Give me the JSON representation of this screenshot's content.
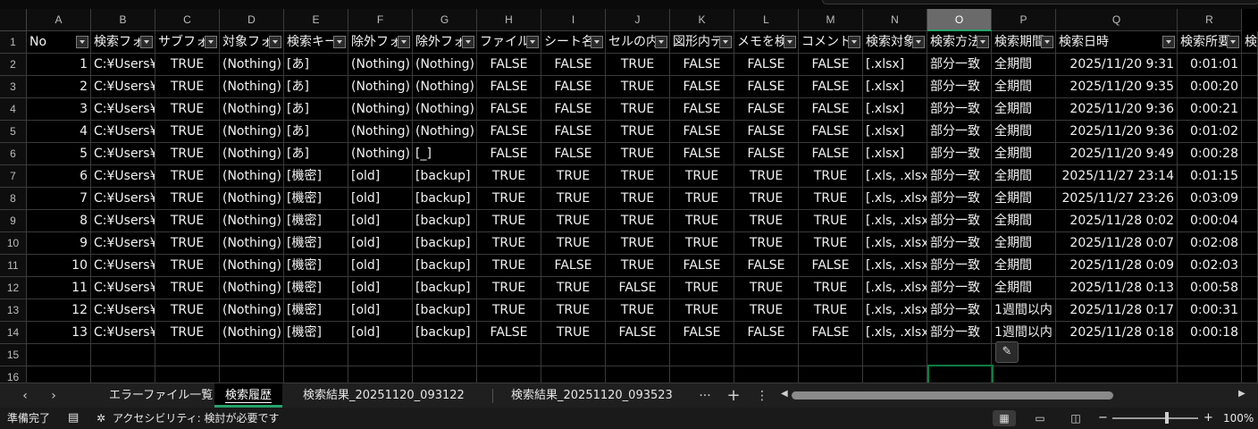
{
  "columns": [
    "A",
    "B",
    "C",
    "D",
    "E",
    "F",
    "G",
    "H",
    "I",
    "J",
    "K",
    "L",
    "M",
    "N",
    "O",
    "P",
    "Q",
    "R"
  ],
  "selected_column": "O",
  "row_numbers": [
    "1",
    "2",
    "3",
    "4",
    "5",
    "6",
    "7",
    "8",
    "9",
    "10",
    "11",
    "12",
    "13",
    "14",
    "15",
    "16"
  ],
  "header_row": [
    "No",
    "検索フォ",
    "サブフォ",
    "対象フォ",
    "検索キー",
    "除外フォ",
    "除外フォ",
    "ファイル",
    "シート名",
    "セルの内",
    "図形内テ",
    "メモを検",
    "コメント",
    "検索対象",
    "検索方法",
    "検索期間",
    "検索日時",
    "検索所要"
  ],
  "header_next_fragment": "検",
  "rows": [
    [
      "1",
      "C:¥Users¥",
      "TRUE",
      "(Nothing)",
      "[あ]",
      "(Nothing)",
      "(Nothing)",
      "FALSE",
      "FALSE",
      "TRUE",
      "FALSE",
      "FALSE",
      "FALSE",
      "[.xlsx]",
      "部分一致",
      "全期間",
      "2025/11/20 9:31",
      "0:01:01"
    ],
    [
      "2",
      "C:¥Users¥",
      "TRUE",
      "(Nothing)",
      "[あ]",
      "(Nothing)",
      "(Nothing)",
      "FALSE",
      "FALSE",
      "TRUE",
      "FALSE",
      "FALSE",
      "FALSE",
      "[.xlsx]",
      "部分一致",
      "全期間",
      "2025/11/20 9:35",
      "0:00:20"
    ],
    [
      "3",
      "C:¥Users¥",
      "TRUE",
      "(Nothing)",
      "[あ]",
      "(Nothing)",
      "(Nothing)",
      "FALSE",
      "FALSE",
      "TRUE",
      "FALSE",
      "FALSE",
      "FALSE",
      "[.xlsx]",
      "部分一致",
      "全期間",
      "2025/11/20 9:36",
      "0:00:21"
    ],
    [
      "4",
      "C:¥Users¥",
      "TRUE",
      "(Nothing)",
      "[あ]",
      "(Nothing)",
      "(Nothing)",
      "FALSE",
      "FALSE",
      "TRUE",
      "FALSE",
      "FALSE",
      "FALSE",
      "[.xlsx]",
      "部分一致",
      "全期間",
      "2025/11/20 9:36",
      "0:01:02"
    ],
    [
      "5",
      "C:¥Users¥",
      "TRUE",
      "(Nothing)",
      "[あ]",
      "(Nothing)",
      "[_]",
      "FALSE",
      "FALSE",
      "TRUE",
      "FALSE",
      "FALSE",
      "FALSE",
      "[.xlsx]",
      "部分一致",
      "全期間",
      "2025/11/20 9:49",
      "0:00:28"
    ],
    [
      "6",
      "C:¥Users¥",
      "TRUE",
      "(Nothing)",
      "[機密]",
      "[old]",
      "[backup]",
      "TRUE",
      "TRUE",
      "TRUE",
      "TRUE",
      "TRUE",
      "TRUE",
      "[.xls, .xlsx,",
      "部分一致",
      "全期間",
      "2025/11/27 23:14",
      "0:01:15"
    ],
    [
      "7",
      "C:¥Users¥",
      "TRUE",
      "(Nothing)",
      "[機密]",
      "[old]",
      "[backup]",
      "TRUE",
      "TRUE",
      "TRUE",
      "TRUE",
      "TRUE",
      "TRUE",
      "[.xls, .xlsx,",
      "部分一致",
      "全期間",
      "2025/11/27 23:26",
      "0:03:09"
    ],
    [
      "8",
      "C:¥Users¥",
      "TRUE",
      "(Nothing)",
      "[機密]",
      "[old]",
      "[backup]",
      "TRUE",
      "TRUE",
      "TRUE",
      "TRUE",
      "TRUE",
      "TRUE",
      "[.xls, .xlsx,",
      "部分一致",
      "全期間",
      "2025/11/28 0:02",
      "0:00:04"
    ],
    [
      "9",
      "C:¥Users¥",
      "TRUE",
      "(Nothing)",
      "[機密]",
      "[old]",
      "[backup]",
      "TRUE",
      "TRUE",
      "TRUE",
      "TRUE",
      "TRUE",
      "TRUE",
      "[.xls, .xlsx,",
      "部分一致",
      "全期間",
      "2025/11/28 0:07",
      "0:02:08"
    ],
    [
      "10",
      "C:¥Users¥",
      "TRUE",
      "(Nothing)",
      "[機密]",
      "[old]",
      "[backup]",
      "TRUE",
      "FALSE",
      "TRUE",
      "FALSE",
      "FALSE",
      "FALSE",
      "[.xls, .xlsx,",
      "部分一致",
      "全期間",
      "2025/11/28 0:09",
      "0:02:03"
    ],
    [
      "11",
      "C:¥Users¥",
      "TRUE",
      "(Nothing)",
      "[機密]",
      "[old]",
      "[backup]",
      "TRUE",
      "TRUE",
      "FALSE",
      "TRUE",
      "TRUE",
      "TRUE",
      "[.xls, .xlsx,",
      "部分一致",
      "全期間",
      "2025/11/28 0:13",
      "0:00:58"
    ],
    [
      "12",
      "C:¥Users¥",
      "TRUE",
      "(Nothing)",
      "[機密]",
      "[old]",
      "[backup]",
      "TRUE",
      "TRUE",
      "TRUE",
      "TRUE",
      "TRUE",
      "TRUE",
      "[.xls, .xlsx,",
      "部分一致",
      "1週間以内",
      "2025/11/28 0:17",
      "0:00:31"
    ],
    [
      "13",
      "C:¥Users¥",
      "TRUE",
      "(Nothing)",
      "[機密]",
      "[old]",
      "[backup]",
      "FALSE",
      "TRUE",
      "FALSE",
      "FALSE",
      "FALSE",
      "FALSE",
      "[.xls, .xlsx,",
      "部分一致",
      "1週間以内",
      "2025/11/28 0:18",
      "0:00:18"
    ]
  ],
  "quick_analysis_icon": "quick-analysis-icon",
  "tabs": {
    "prev_arrow": "‹",
    "next_arrow": "›",
    "items": [
      {
        "label": "エラーファイル一覧",
        "active": false
      },
      {
        "label": "検索履歴",
        "active": true
      },
      {
        "label": "検索結果_20251120_093122",
        "active": false
      },
      {
        "label": "検索結果_20251120_093523",
        "active": false
      }
    ],
    "more": "···",
    "add": "+",
    "options": "⋮"
  },
  "status": {
    "ready": "準備完了",
    "accessibility": "アクセシビリティ: 検討が必要です",
    "zoom_minus": "−",
    "zoom_plus": "+",
    "zoom": "100%",
    "zoom_fraction": 0.64
  },
  "colors": {
    "accent": "#107c41",
    "selected_header": "#6a6a6a",
    "grid": "#3a3a3a",
    "background": "#000000"
  }
}
